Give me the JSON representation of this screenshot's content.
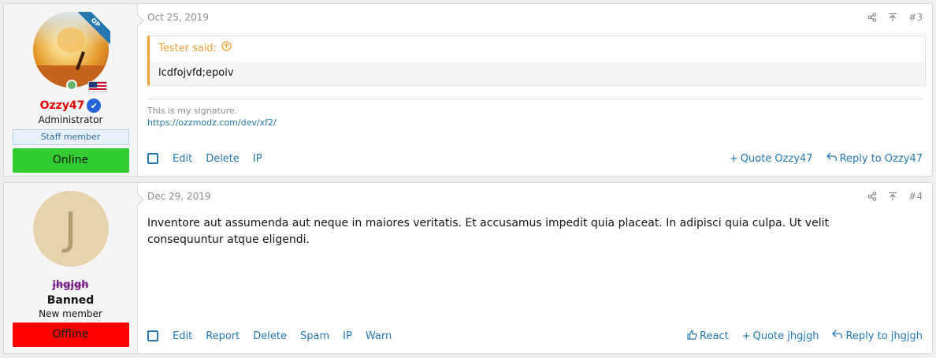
{
  "posts": [
    {
      "author": {
        "username": "Ozzy47",
        "title": "Administrator",
        "badge": "Staff member",
        "status": "Online",
        "ribbon": "OP",
        "avatar_letter": "",
        "verified": true
      },
      "date": "Oct 25, 2019",
      "number": "#3",
      "quote": {
        "author_line": "Tester said:",
        "text": "lcdfojvfd;epoiv"
      },
      "signature": {
        "text": "This is my signature.",
        "link": "https://ozzmodz.com/dev/xf2/"
      },
      "actions_left": [
        "Edit",
        "Delete",
        "IP"
      ],
      "actions_right": [
        "Quote Ozzy47",
        "Reply to Ozzy47"
      ]
    },
    {
      "author": {
        "username": "jhgjgh",
        "banned_label": "Banned",
        "title": "New member",
        "status": "Offline",
        "avatar_letter": "J"
      },
      "date": "Dec 29, 2019",
      "number": "#4",
      "body": "Inventore aut assumenda aut neque in maiores veritatis. Et accusamus impedit quia placeat. In adipisci quia culpa. Ut velit consequuntur atque eligendi.",
      "actions_left": [
        "Edit",
        "Report",
        "Delete",
        "Spam",
        "IP",
        "Warn"
      ],
      "actions_right": [
        "React",
        "Quote jhgjgh",
        "Reply to jhgjgh"
      ]
    }
  ],
  "icons": {
    "share": "share-icon",
    "bookmark": "go-to-top-icon",
    "quote_arrow": "arrow-up-circle-icon",
    "plus": "plus-icon",
    "reply": "reply-icon",
    "thumb": "thumbs-up-icon"
  },
  "colors": {
    "link": "#2577b1",
    "quote_accent": "#f3a13b",
    "admin_name": "#e00000",
    "online": "#33cc33",
    "offline": "#ff0000"
  }
}
